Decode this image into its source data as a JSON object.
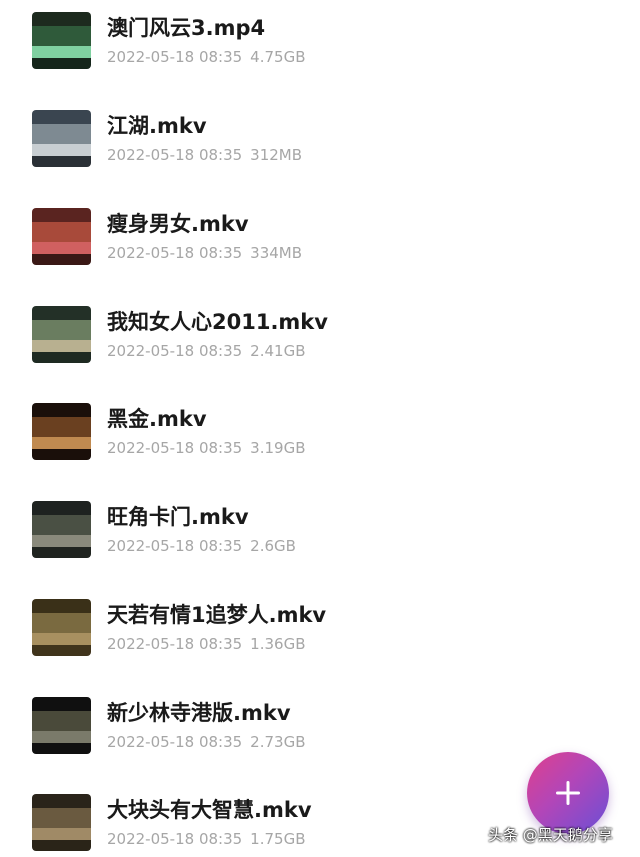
{
  "files": [
    {
      "name": "澳门风云3.mp4",
      "date": "2022-05-18 08:35",
      "size": "4.75GB",
      "thumb_colors": [
        "#1d2a1e",
        "#2f5a3a",
        "#7fd0a0",
        "#15251b"
      ]
    },
    {
      "name": "江湖.mkv",
      "date": "2022-05-18 08:35",
      "size": "312MB",
      "thumb_colors": [
        "#3a4550",
        "#7e8a92",
        "#c8ced2",
        "#2a3036"
      ]
    },
    {
      "name": "瘦身男女.mkv",
      "date": "2022-05-18 08:35",
      "size": "334MB",
      "thumb_colors": [
        "#5a2420",
        "#a84a3a",
        "#d06060",
        "#3a1815"
      ]
    },
    {
      "name": "我知女人心2011.mkv",
      "date": "2022-05-18 08:35",
      "size": "2.41GB",
      "thumb_colors": [
        "#233027",
        "#6a7d60",
        "#b8b090",
        "#1e2a22"
      ]
    },
    {
      "name": "黑金.mkv",
      "date": "2022-05-18 08:35",
      "size": "3.19GB",
      "thumb_colors": [
        "#1a0f0a",
        "#6a4020",
        "#c08a50",
        "#1a0f0a"
      ]
    },
    {
      "name": "旺角卡门.mkv",
      "date": "2022-05-18 08:35",
      "size": "2.6GB",
      "thumb_colors": [
        "#1e2220",
        "#4a5044",
        "#8a8a7c",
        "#202420"
      ]
    },
    {
      "name": "天若有情1追梦人.mkv",
      "date": "2022-05-18 08:35",
      "size": "1.36GB",
      "thumb_colors": [
        "#3a3018",
        "#7a6a40",
        "#a89060",
        "#40341c"
      ]
    },
    {
      "name": "新少林寺港版.mkv",
      "date": "2022-05-18 08:35",
      "size": "2.73GB",
      "thumb_colors": [
        "#101010",
        "#4a4a3a",
        "#7a7a6a",
        "#101010"
      ]
    },
    {
      "name": "大块头有大智慧.mkv",
      "date": "2022-05-18 08:35",
      "size": "1.75GB",
      "thumb_colors": [
        "#2a241a",
        "#6a5a40",
        "#a08a66",
        "#2a2418"
      ]
    }
  ],
  "fab": {
    "icon": "plus-icon",
    "color": "#b246b8"
  },
  "watermark": {
    "text": "头条 @黑天鹅分享"
  }
}
